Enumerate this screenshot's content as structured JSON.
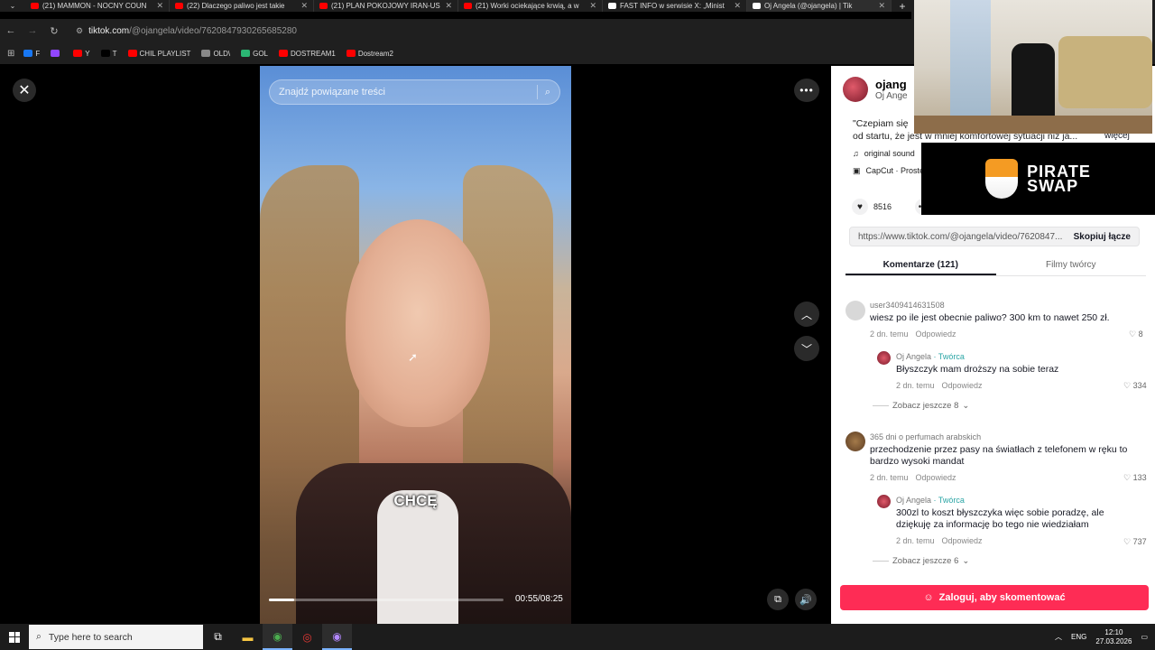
{
  "browser": {
    "tabs": [
      {
        "title": "(21) MAMMON - NOCNY COUN",
        "favicon_color": "#ff0000",
        "active": false
      },
      {
        "title": "(22) Dlaczego paliwo jest takie",
        "favicon_color": "#ff0000",
        "active": false
      },
      {
        "title": "(21) PLAN POKOJOWY IRAN-US",
        "favicon_color": "#ff0000",
        "active": false
      },
      {
        "title": "(21) Worki ociekające krwią, a w",
        "favicon_color": "#ff0000",
        "active": false
      },
      {
        "title": "FAST INFO w serwisie X: „Minist",
        "favicon_color": "#ffffff",
        "active": false
      },
      {
        "title": "Oj Angela (@ojangela) | Tik",
        "favicon_color": "#ffffff",
        "active": true
      }
    ],
    "url_host": "tiktok.com",
    "url_path": "/@ojangela/video/7620847930265685280",
    "bookmarks": [
      {
        "label": "F",
        "color": "#1877f2"
      },
      {
        "label": "",
        "color": "#9146ff"
      },
      {
        "label": "Y",
        "color": "#ff0000"
      },
      {
        "label": "T",
        "color": "#000000"
      },
      {
        "label": "CHIL PLAYLIST",
        "color": "#ff0000"
      },
      {
        "label": "OLD\\",
        "color": "#888888"
      },
      {
        "label": "GOL",
        "color": "#2bb673"
      },
      {
        "label": "DOSTREAM1",
        "color": "#ff0000"
      },
      {
        "label": "Dostream2",
        "color": "#ff0000"
      }
    ]
  },
  "video": {
    "search_placeholder": "Znajdź powiązane treści",
    "caption": "CHCĘ",
    "time": "00:55/08:25",
    "progress": 0.109
  },
  "panel": {
    "author_name": "ojang",
    "author_sub": "Oj Ange",
    "desc_line1": "\"Czepiam się",
    "desc_line2": "od startu, że jest w mniej komfortowej sytuacji niż ja...",
    "more": "więcej",
    "sound": "original sound",
    "capcut": "CapCut · Proste",
    "likes": "8516",
    "share_url": "https://www.tiktok.com/@ojangela/video/7620847...",
    "copy_link": "Skopiuj łącze",
    "tab_comments": "Komentarze (121)",
    "tab_videos": "Filmy twórcy",
    "comments": [
      {
        "user": "user3409414631508",
        "text": "wiesz po ile jest obecnie paliwo? 300 km to nawet 250 zł.",
        "date": "2 dn. temu",
        "reply": "Odpowiedz",
        "likes": "8"
      },
      {
        "user": "Oj Angela",
        "creator_tag": "· Twórca",
        "text": "Błyszczyk mam droższy na sobie teraz",
        "date": "2 dn. temu",
        "reply": "Odpowiedz",
        "likes": "334"
      },
      {
        "user": "365 dni o perfumach arabskich",
        "text": "przechodzenie przez pasy na światłach z telefonem w ręku to bardzo wysoki mandat",
        "date": "2 dn. temu",
        "reply": "Odpowiedz",
        "likes": "133"
      },
      {
        "user": "Oj Angela",
        "creator_tag": "· Twórca",
        "text": "300zl to koszt błyszczyka więc sobie poradzę, ale dziękuję za informację bo tego nie wiedziałam",
        "date": "2 dn. temu",
        "reply": "Odpowiedz",
        "likes": "737"
      }
    ],
    "show_more_1": "Zobacz jeszcze 8",
    "show_more_2": "Zobacz jeszcze 6",
    "login": "Zaloguj, aby skomentować"
  },
  "overlay": {
    "pirate_line1": "PIRATE",
    "pirate_line2": "SWAP"
  },
  "taskbar": {
    "search_placeholder": "Type here to search",
    "lang": "ENG",
    "time": "12:10",
    "date": "27.03.2026"
  },
  "colors": {
    "accent": "#fe2c55",
    "creator": "#2aa5a5"
  }
}
